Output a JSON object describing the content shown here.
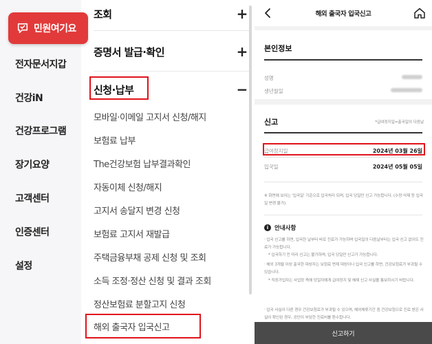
{
  "left_nav": {
    "top_button": "민원여기요",
    "items": [
      "전자문서지갑",
      "건강iN",
      "건강프로그램",
      "장기요양",
      "고객센터",
      "인증센터",
      "설정"
    ]
  },
  "menu": {
    "sections": [
      {
        "label": "조회",
        "toggle": "+"
      },
      {
        "label": "증명서 발급·확인",
        "toggle": "+"
      },
      {
        "label": "신청·납부",
        "toggle": "−"
      }
    ],
    "sub_items": [
      "모바일·이메일 고지서 신청/해지",
      "보험료 납부",
      "The건강보험 납부결과확인",
      "자동이체 신청/해지",
      "고지서 송달지 변경 신청",
      "보험료 고지서 재발급",
      "주택금융부채 공제 신청 및 조회",
      "소득 조정·정산 신청 및 결과 조회",
      "정산보험료 분할고지 신청",
      "해외 출국자 입국신고"
    ]
  },
  "phone": {
    "title": "해외 출국자 입국신고",
    "identity": {
      "title": "본인정보",
      "rows": [
        {
          "label": "성명"
        },
        {
          "label": "생년월일"
        }
      ]
    },
    "report": {
      "title": "신고",
      "note": "*급여정지일=출국일의 다음날",
      "rows": [
        {
          "label": "급여정지일",
          "value": "2024년 03월 26일"
        },
        {
          "label": "입국일",
          "value": "2024년 05월 05일"
        }
      ],
      "info_text": "※ 화면에 보이는 '입국일' 기준으로 입국처리 되며, 입국 당일만 신고 가능합니다. (수정·삭제 등 입국일 변경 불가)",
      "guide_title": "안내사항",
      "guide_items": [
        "· 입국 신고를 하면, 입국한 날부터 바로 진료가 가능하며 입국일의 다음날부터는 입국 신고 없이도 진료가 가능합니다.",
        "* 입국하기 전 미리 신고는 불가하며, 입국 당일만 신고가 가능합니다.",
        "· 해외 3개월 이상 출국한 대상자는 보험료 면제 대상이나 입국 신고를 하면, 건강보험료가 부과될 수 있습니다.",
        "* 직장가입자는 사업장 측에 당일자에게 급여정지 및 해제 신고 사실을 통보하시기 바랍니다.",
        "· 입국 사실이 다른 경우 건강보험료가 부과될 수 있으며, 해외체류기간 중 건강보험으로 진료 받은 사실이 확인된 경우, 공단이 부담한 진료비를 환수합니다."
      ]
    },
    "submit": "신고하기"
  }
}
